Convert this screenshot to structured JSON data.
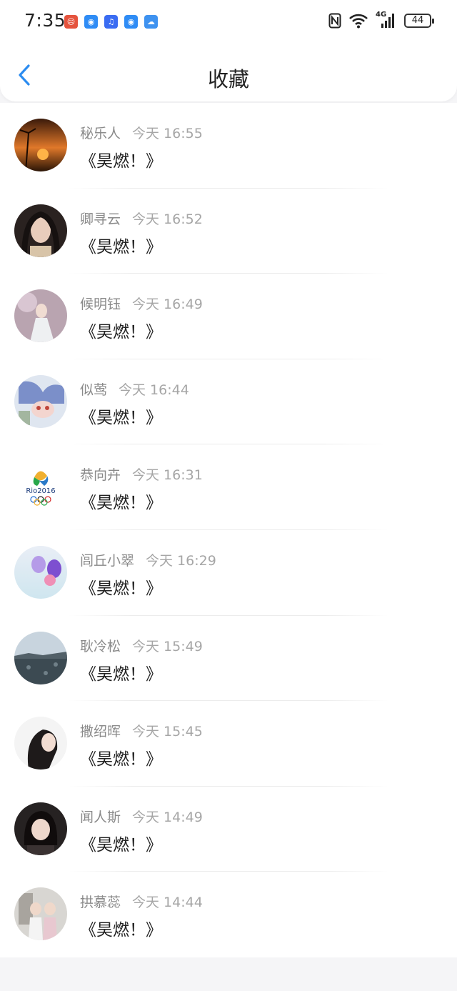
{
  "status_bar": {
    "time": "7:35",
    "network": "4G",
    "battery": "44"
  },
  "header": {
    "title": "收藏"
  },
  "items": [
    {
      "name": "秘乐人",
      "time": "今天 16:55",
      "message": "《昊燃！》"
    },
    {
      "name": "卿寻云",
      "time": "今天 16:52",
      "message": "《昊燃！》"
    },
    {
      "name": "候明钰",
      "time": "今天 16:49",
      "message": "《昊燃！》"
    },
    {
      "name": "似莺",
      "time": "今天 16:44",
      "message": "《昊燃！》"
    },
    {
      "name": "恭向卉",
      "time": "今天 16:31",
      "message": "《昊燃！》"
    },
    {
      "name": "闾丘小翠",
      "time": "今天 16:29",
      "message": "《昊燃！》"
    },
    {
      "name": "耿冷松",
      "time": "今天 15:49",
      "message": "《昊燃！》"
    },
    {
      "name": "撒绍晖",
      "time": "今天 15:45",
      "message": "《昊燃！》"
    },
    {
      "name": "闻人斯",
      "time": "今天 14:49",
      "message": "《昊燃！》"
    },
    {
      "name": "拱慕蕊",
      "time": "今天 14:44",
      "message": "《昊燃！》"
    }
  ],
  "colors": {
    "accent": "#2b8cf0",
    "background": "#f5f5f7"
  }
}
